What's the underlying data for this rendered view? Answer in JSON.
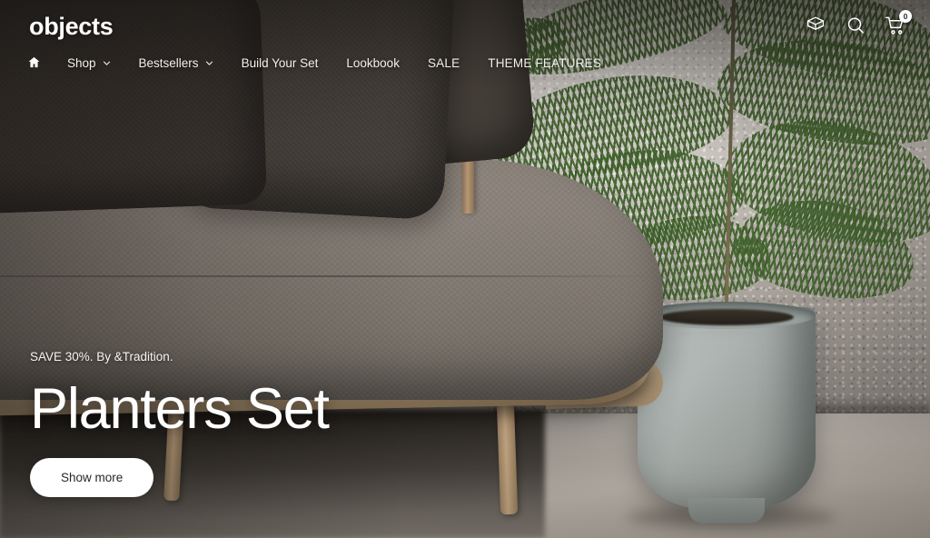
{
  "site": {
    "logo": "objects"
  },
  "nav": {
    "items": [
      {
        "label": "",
        "icon": "home-icon",
        "has_caret": false,
        "uppercase": false
      },
      {
        "label": "Shop",
        "icon": "",
        "has_caret": true,
        "uppercase": false
      },
      {
        "label": "Bestsellers",
        "icon": "",
        "has_caret": true,
        "uppercase": false
      },
      {
        "label": "Build Your Set",
        "icon": "",
        "has_caret": false,
        "uppercase": false
      },
      {
        "label": "Lookbook",
        "icon": "",
        "has_caret": false,
        "uppercase": false
      },
      {
        "label": "SALE",
        "icon": "",
        "has_caret": false,
        "uppercase": true
      },
      {
        "label": "THEME FEATURES",
        "icon": "",
        "has_caret": false,
        "uppercase": true
      }
    ]
  },
  "actions": {
    "package": {
      "icon": "package-box-icon"
    },
    "search": {
      "icon": "search-icon"
    },
    "cart": {
      "icon": "shopping-cart-icon",
      "count": "0"
    }
  },
  "hero": {
    "eyebrow": "SAVE 30%. By &Tradition.",
    "headline": "Planters Set",
    "cta_label": "Show more"
  },
  "colors": {
    "text_on_image": "#ffffff",
    "cta_background": "#ffffff",
    "cta_text": "#292623",
    "badge_background": "#ffffff",
    "badge_text": "#2b2b2b"
  }
}
